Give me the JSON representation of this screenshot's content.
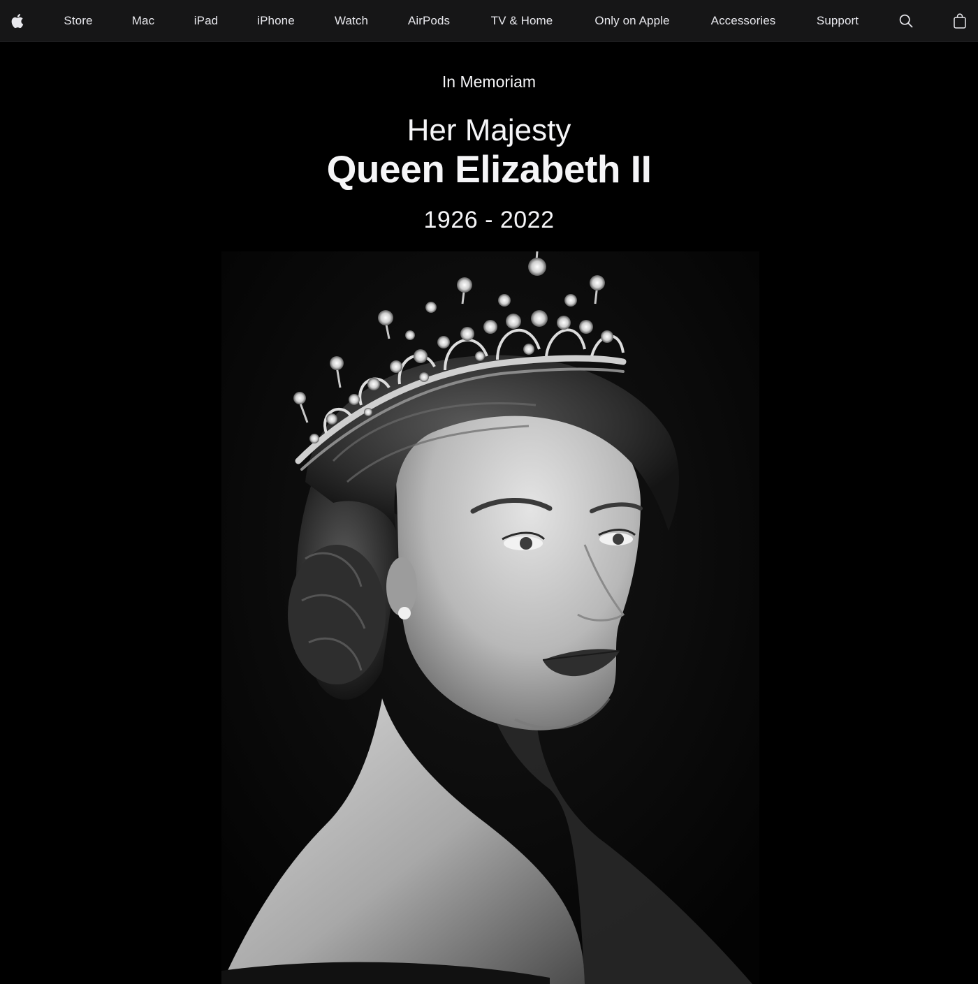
{
  "nav": {
    "apple_logo_icon": "apple-logo-icon",
    "items": [
      {
        "label": "Store"
      },
      {
        "label": "Mac"
      },
      {
        "label": "iPad"
      },
      {
        "label": "iPhone"
      },
      {
        "label": "Watch"
      },
      {
        "label": "AirPods"
      },
      {
        "label": "TV & Home"
      },
      {
        "label": "Only on Apple"
      },
      {
        "label": "Accessories"
      },
      {
        "label": "Support"
      }
    ],
    "search_icon": "search-icon",
    "bag_icon": "shopping-bag-icon",
    "background_color": "#161617",
    "text_color": "#e8e8ed"
  },
  "hero": {
    "eyebrow": "In Memoriam",
    "title_line1": "Her Majesty",
    "title_line2": "Queen Elizabeth II",
    "dates": "1926 - 2022",
    "portrait_style": "black-and-white photograph",
    "background_color": "#000000",
    "text_color": "#f5f5f7"
  }
}
